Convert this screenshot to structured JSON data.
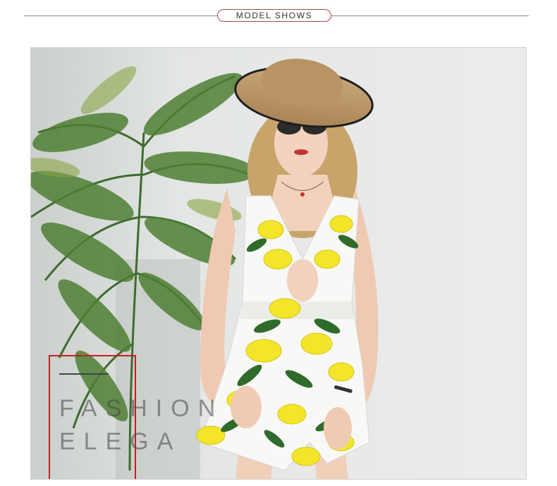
{
  "section": {
    "title": "MODEL SHOWS"
  },
  "photo": {
    "subject": "model-photo",
    "watermark": {
      "line1": "FASHION",
      "line2": "ELEGA"
    }
  },
  "colors": {
    "accent": "#b5474d",
    "divider": "#8a8a8a",
    "wall": "#eceeed",
    "lemon": "#f3e62a",
    "leaf": "#2f6b2a"
  }
}
